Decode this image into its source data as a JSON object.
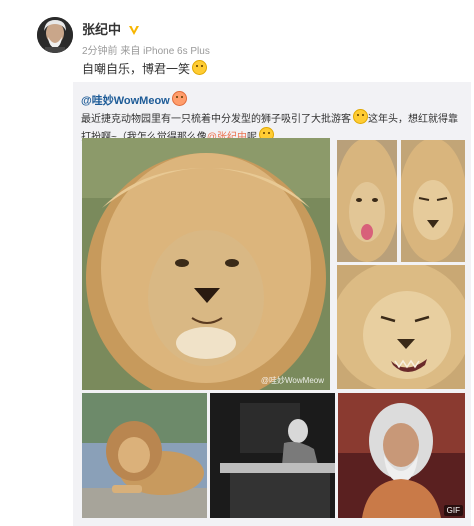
{
  "author": {
    "name": "张纪中",
    "meta": "2分钟前 来自 iPhone 6s Plus",
    "post_text": "自嘲自乐，博君一笑"
  },
  "repost": {
    "author": "@哇妙WowMeow",
    "text_part1": "最近捷克动物园里有一只梳着中分发型的狮子吸引了大批游客",
    "text_part2": "这年头，想红就得靠打扮啊~（我怎么觉得那么像",
    "mention": "@张纪中",
    "text_part3": "呢"
  },
  "images": {
    "watermark": "@哇妙WowMeow",
    "gif_badge": "GIF"
  },
  "colors": {
    "link": "#1d5b97",
    "mention": "#eb7350",
    "repost_bg": "#f2f2f5",
    "vip": "#f7b500"
  }
}
